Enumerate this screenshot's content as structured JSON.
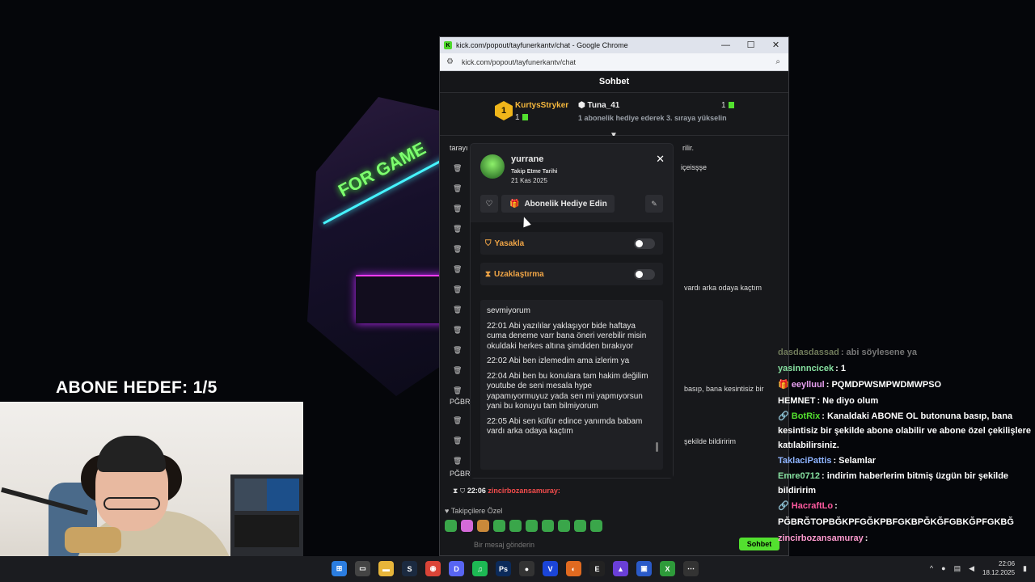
{
  "stream": {
    "abone_hedef": "ABONE HEDEF: 1/5"
  },
  "browser": {
    "title": "kick.com/popout/tayfunerkantv/chat - Google Chrome",
    "url": "kick.com/popout/tayfunerkantv/chat",
    "min": "—",
    "max": "☐",
    "close": "✕"
  },
  "chat": {
    "header": "Sohbet",
    "leader": {
      "rank": "1",
      "name": "KurtysStryker",
      "count": "1",
      "second_name": "Tuna_41",
      "second_count": "1",
      "message": "1 abonelik hediye ederek 3. sıraya yükselin"
    },
    "bg_lines": [
      "tarayı",
      "rilir.",
      "içeisşşe",
      "vardı arka odaya kaçtım",
      "basıp, bana kesintisiz bir",
      "şekilde bildiririm",
      "PĞBR"
    ],
    "bg_left_second": "şekil",
    "popup": {
      "username": "yurrane",
      "follow_label": "Takip Etme Tarihi",
      "follow_date": "21 Kas 2025",
      "gift_label": "Abonelik Hediye Edin",
      "ban_label": "Yasakla",
      "timeout_label": "Uzaklaştırma",
      "history": [
        "sevmiyorum",
        "22:01 Abi yazılılar yaklaşıyor bide haftaya cuma deneme varr bana öneri verebilir misin okuldaki herkes altına şimdiden bırakıyor",
        "22:02 Abi ben izlemedim ama izlerim ya",
        "22:04 Abi ben bu konulara tam hakim değilim youtube de seni mesala hype yapamıyormuyuz yada sen mi yapmıyorsun yani bu konuyu tam bilmiyorum",
        "22:05 Abi sen küfür edince yanımda babam vardı arka odaya kaçtım"
      ]
    },
    "latest": {
      "time": "22:06",
      "user": "zincirbozansamuray:"
    },
    "follower_only": "Takipçilere Özel",
    "input_placeholder": "Bir mesaj gönderin",
    "send_label": "Sohbet"
  },
  "overlay_chat": [
    {
      "user": "dasdasdassad",
      "color": "#6f7a5a",
      "text": ": abi söylesene ya"
    },
    {
      "user": "yasinnncicek",
      "color": "#86e0a0",
      "text": ": 1"
    },
    {
      "user": "eeylluul",
      "color": "#e7a0f0",
      "text": ": PQMDPWSMPWDMWPSO"
    },
    {
      "user": "HEMNET",
      "color": "#ffffff",
      "text": ": Ne diyo olum"
    },
    {
      "user": "BotRix",
      "color": "#53e02f",
      "text": ": Kanaldaki ABONE OL butonuna basıp, bana kesintisiz bir şekilde abone olabilir ve abone özel çekilişlere katılabilirsiniz."
    },
    {
      "user": "TaklaciPattis",
      "color": "#8fb4ff",
      "text": ": Selamlar"
    },
    {
      "user": "Emre0712",
      "color": "#86e0a0",
      "text": ": indirim haberlerim bitmiş üzgün bir şekilde bildiririm"
    },
    {
      "user": "HacraftLo",
      "color": "#ff5aa0",
      "text": ":"
    },
    {
      "user": "",
      "color": "#ffffff",
      "text": "PĞBRĞTOPBĞKPFGĞKPBFGKBPĞKĞFGBKĞPFGKBĞ"
    },
    {
      "user": "zincirbozansamuray",
      "color": "#ff9bd0",
      "text": ":"
    }
  ],
  "taskbar": {
    "time": "22:06",
    "date": "18.12.2025"
  }
}
